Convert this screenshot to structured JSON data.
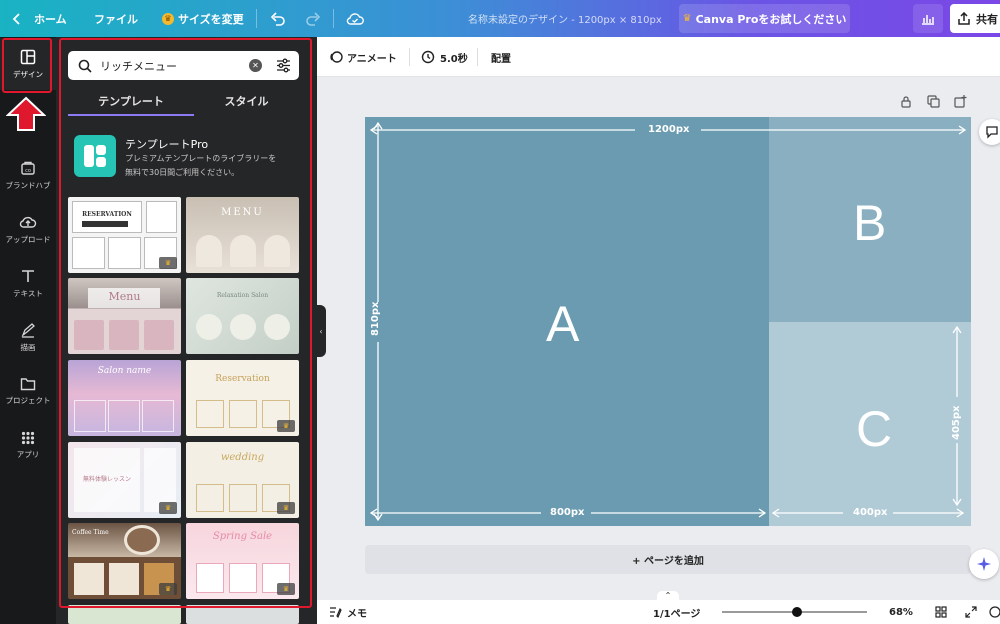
{
  "topbar": {
    "home_label": "ホーム",
    "file_label": "ファイル",
    "resize_label": "サイズを変更",
    "doc_title": "名称未設定のデザイン - 1200px × 810px",
    "pro_label": "Canva Proをお試しください",
    "share_label": "共有"
  },
  "rail": {
    "items": [
      {
        "label": "デザイン",
        "icon": "layout-icon"
      },
      {
        "label": "ブランドハブ",
        "icon": "brand-icon"
      },
      {
        "label": "アップロード",
        "icon": "upload-icon"
      },
      {
        "label": "テキスト",
        "icon": "text-icon"
      },
      {
        "label": "描画",
        "icon": "draw-icon"
      },
      {
        "label": "プロジェクト",
        "icon": "folder-icon"
      },
      {
        "label": "アプリ",
        "icon": "apps-icon"
      }
    ]
  },
  "panel": {
    "search_value": "リッチメニュー",
    "tabs": [
      {
        "label": "テンプレート"
      },
      {
        "label": "スタイル"
      }
    ],
    "promo_title": "テンプレートPro",
    "promo_desc_1": "プレミアムテンプレートのライブラリーを",
    "promo_desc_2": "無料で30日間ご利用ください。",
    "thumbs": [
      {
        "label": "RESERVATION"
      },
      {
        "label": "MENU"
      },
      {
        "label": "Menu"
      },
      {
        "label": "Relaxation Salon"
      },
      {
        "label": "Salon name"
      },
      {
        "label": "Reservation"
      },
      {
        "label": "無料体験レッスン"
      },
      {
        "label": "wedding"
      },
      {
        "label": "Coffee Time"
      },
      {
        "label": "Spring Sale"
      }
    ]
  },
  "editor": {
    "animate_label": "アニメート",
    "duration_label": "5.0秒",
    "position_label": "配置"
  },
  "canvas": {
    "letter_a": "A",
    "letter_b": "B",
    "letter_c": "C",
    "width_total": "1200px",
    "height_total": "810px",
    "width_a": "800px",
    "width_c": "400px",
    "height_c": "405px",
    "colors": {
      "a": "#6a9bb0",
      "b": "#8aafc0",
      "c": "#b0cad6"
    }
  },
  "add_page_label": "+ ページを追加",
  "bottombar": {
    "notes_label": "メモ",
    "page_label": "1/1ページ",
    "zoom_label": "68%",
    "zoom_value": 0.52
  }
}
